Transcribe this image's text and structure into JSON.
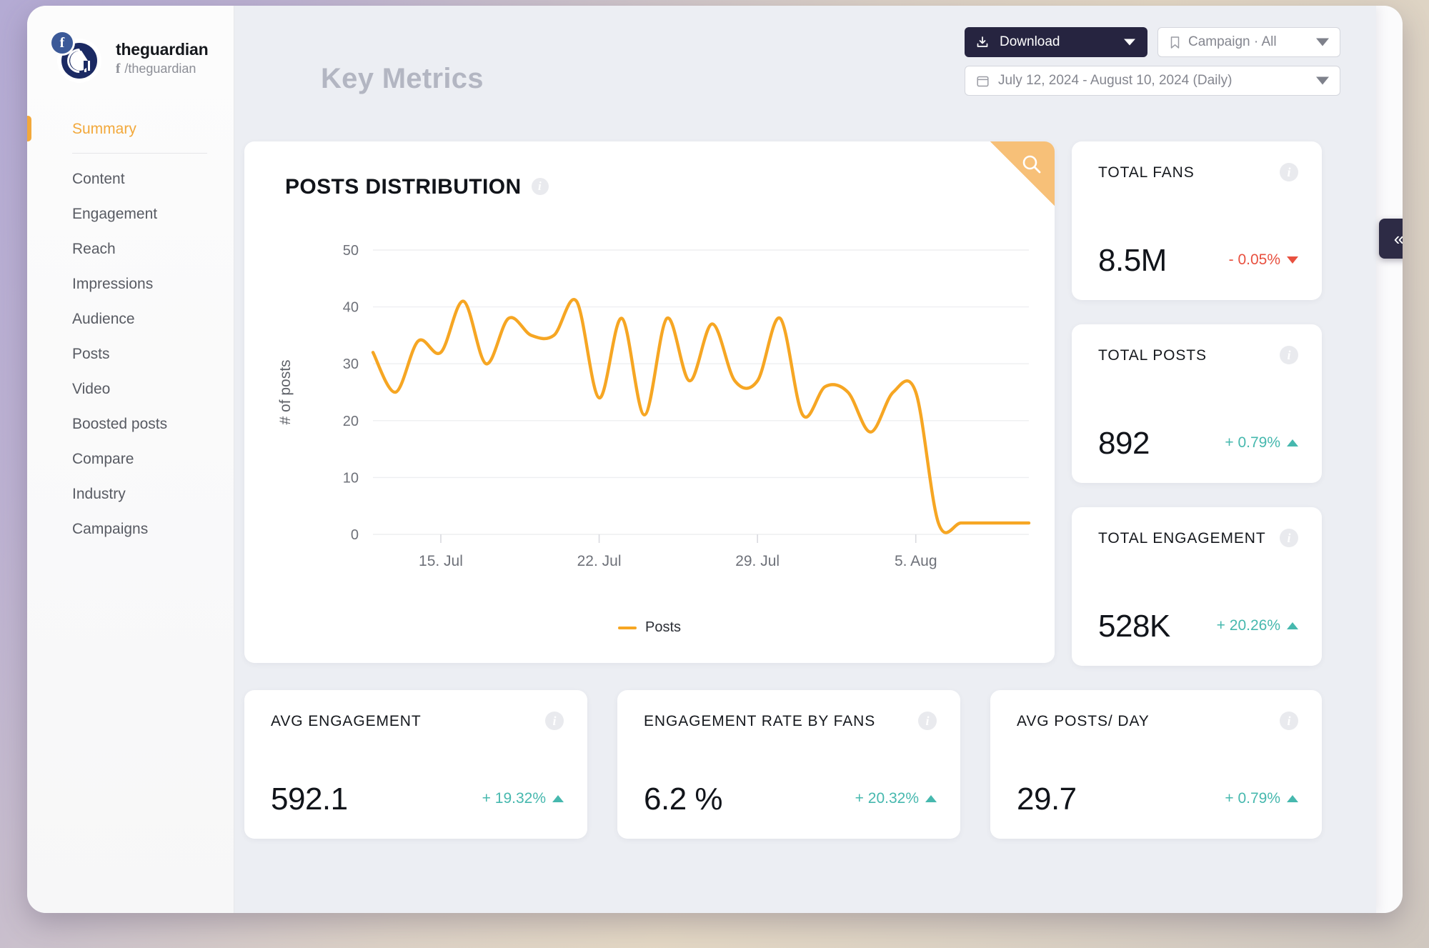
{
  "brand": {
    "handle": "theguardian",
    "network_glyph": "f",
    "page_path": "/theguardian",
    "avatar_letter": "G",
    "facebook_badge": "f"
  },
  "sidebar": {
    "items": [
      {
        "label": "Summary",
        "active": true
      },
      {
        "label": "Content",
        "active": false
      },
      {
        "label": "Engagement",
        "active": false
      },
      {
        "label": "Reach",
        "active": false
      },
      {
        "label": "Impressions",
        "active": false
      },
      {
        "label": "Audience",
        "active": false
      },
      {
        "label": "Posts",
        "active": false
      },
      {
        "label": "Video",
        "active": false
      },
      {
        "label": "Boosted posts",
        "active": false
      },
      {
        "label": "Compare",
        "active": false
      },
      {
        "label": "Industry",
        "active": false
      },
      {
        "label": "Campaigns",
        "active": false
      }
    ]
  },
  "header": {
    "title": "Key Metrics",
    "download_label": "Download",
    "campaign_label": "Campaign · All",
    "date_range_label": "July 12, 2024 - August 10, 2024 (Daily)"
  },
  "chart_card": {
    "title": "POSTS DISTRIBUTION",
    "info_glyph": "i",
    "search_icon": "search-icon"
  },
  "chart_data": {
    "type": "line",
    "title": "POSTS DISTRIBUTION",
    "xlabel": "",
    "ylabel": "# of posts",
    "ylim": [
      0,
      50
    ],
    "yticks": [
      0,
      10,
      20,
      30,
      40,
      50
    ],
    "xtick_labels": [
      "15. Jul",
      "22. Jul",
      "29. Jul",
      "5. Aug"
    ],
    "xtick_indices": [
      3,
      10,
      17,
      24
    ],
    "grid": true,
    "legend": [
      "Posts"
    ],
    "legend_position": "bottom",
    "line_color": "#f6a623",
    "x": [
      "12. Jul",
      "13. Jul",
      "14. Jul",
      "15. Jul",
      "16. Jul",
      "17. Jul",
      "18. Jul",
      "19. Jul",
      "20. Jul",
      "21. Jul",
      "22. Jul",
      "23. Jul",
      "24. Jul",
      "25. Jul",
      "26. Jul",
      "27. Jul",
      "28. Jul",
      "29. Jul",
      "30. Jul",
      "31. Jul",
      "1. Aug",
      "2. Aug",
      "3. Aug",
      "4. Aug",
      "5. Aug",
      "6. Aug",
      "7. Aug",
      "8. Aug",
      "9. Aug",
      "10. Aug"
    ],
    "series": [
      {
        "name": "Posts",
        "values": [
          32,
          25,
          34,
          32,
          41,
          30,
          38,
          35,
          35,
          41,
          24,
          38,
          21,
          38,
          27,
          37,
          27,
          27,
          38,
          21,
          26,
          25,
          18,
          25,
          25,
          2,
          2,
          2,
          2,
          2
        ]
      }
    ]
  },
  "kpi_cards": [
    {
      "title": "TOTAL FANS",
      "value": "8.5M",
      "delta": "- 0.05%",
      "direction": "down",
      "info_glyph": "i"
    },
    {
      "title": "TOTAL POSTS",
      "value": "892",
      "delta": "+ 0.79%",
      "direction": "up",
      "info_glyph": "i"
    },
    {
      "title": "TOTAL ENGAGEMENT",
      "value": "528K",
      "delta": "+ 20.26%",
      "direction": "up",
      "info_glyph": "i"
    },
    {
      "title": "AVG ENGAGEMENT",
      "value": "592.1",
      "delta": "+ 19.32%",
      "direction": "up",
      "info_glyph": "i"
    },
    {
      "title": "ENGAGEMENT RATE BY FANS",
      "value": "6.2 %",
      "delta": "+ 20.32%",
      "direction": "up",
      "info_glyph": "i"
    },
    {
      "title": "AVG POSTS/ DAY",
      "value": "29.7",
      "delta": "+ 0.79%",
      "direction": "up",
      "info_glyph": "i"
    }
  ],
  "collapse": {
    "glyph": "«"
  },
  "colors": {
    "accent_orange": "#f6a623",
    "positive": "#46b8ae",
    "negative": "#e8503f",
    "dark": "#262440"
  }
}
